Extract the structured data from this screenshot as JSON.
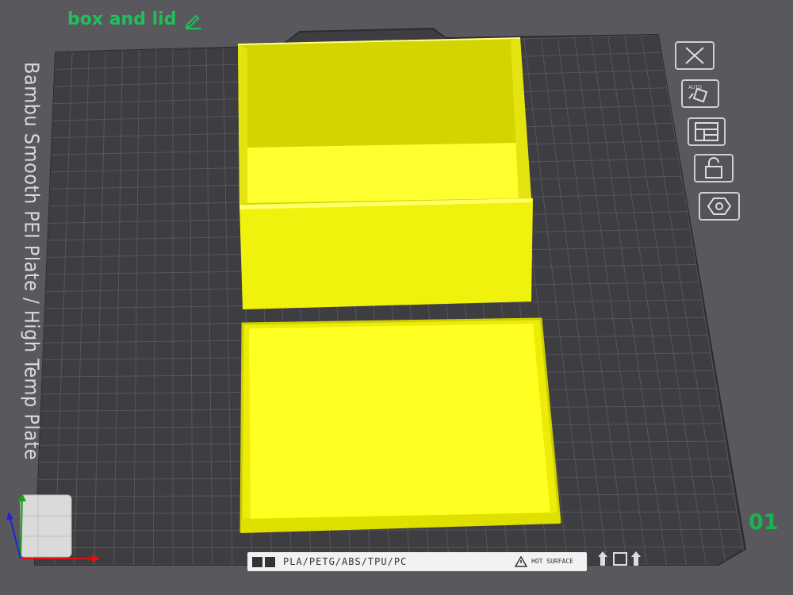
{
  "project": {
    "title": "box and lid",
    "edit_icon": "pencil-icon"
  },
  "plate": {
    "label": "Bambu Smooth PEI Plate / High Temp Plate",
    "number": "01",
    "footer": {
      "materials": "PLA/PETG/ABS/TPU/PC",
      "warning": "HOT SURFACE"
    }
  },
  "toolbar": {
    "items": [
      {
        "name": "close-plate",
        "icon": "close-icon"
      },
      {
        "name": "auto-orient",
        "icon": "auto-orient-icon"
      },
      {
        "name": "arrange",
        "icon": "arrange-icon"
      },
      {
        "name": "lock",
        "icon": "unlock-icon"
      },
      {
        "name": "settings",
        "icon": "hexagon-settings-icon"
      }
    ]
  },
  "colors": {
    "background": "#59595d",
    "plate": "#3e3e42",
    "model": "#f3f30a",
    "title": "#1fbf5b",
    "plate_number": "#19b44f"
  }
}
